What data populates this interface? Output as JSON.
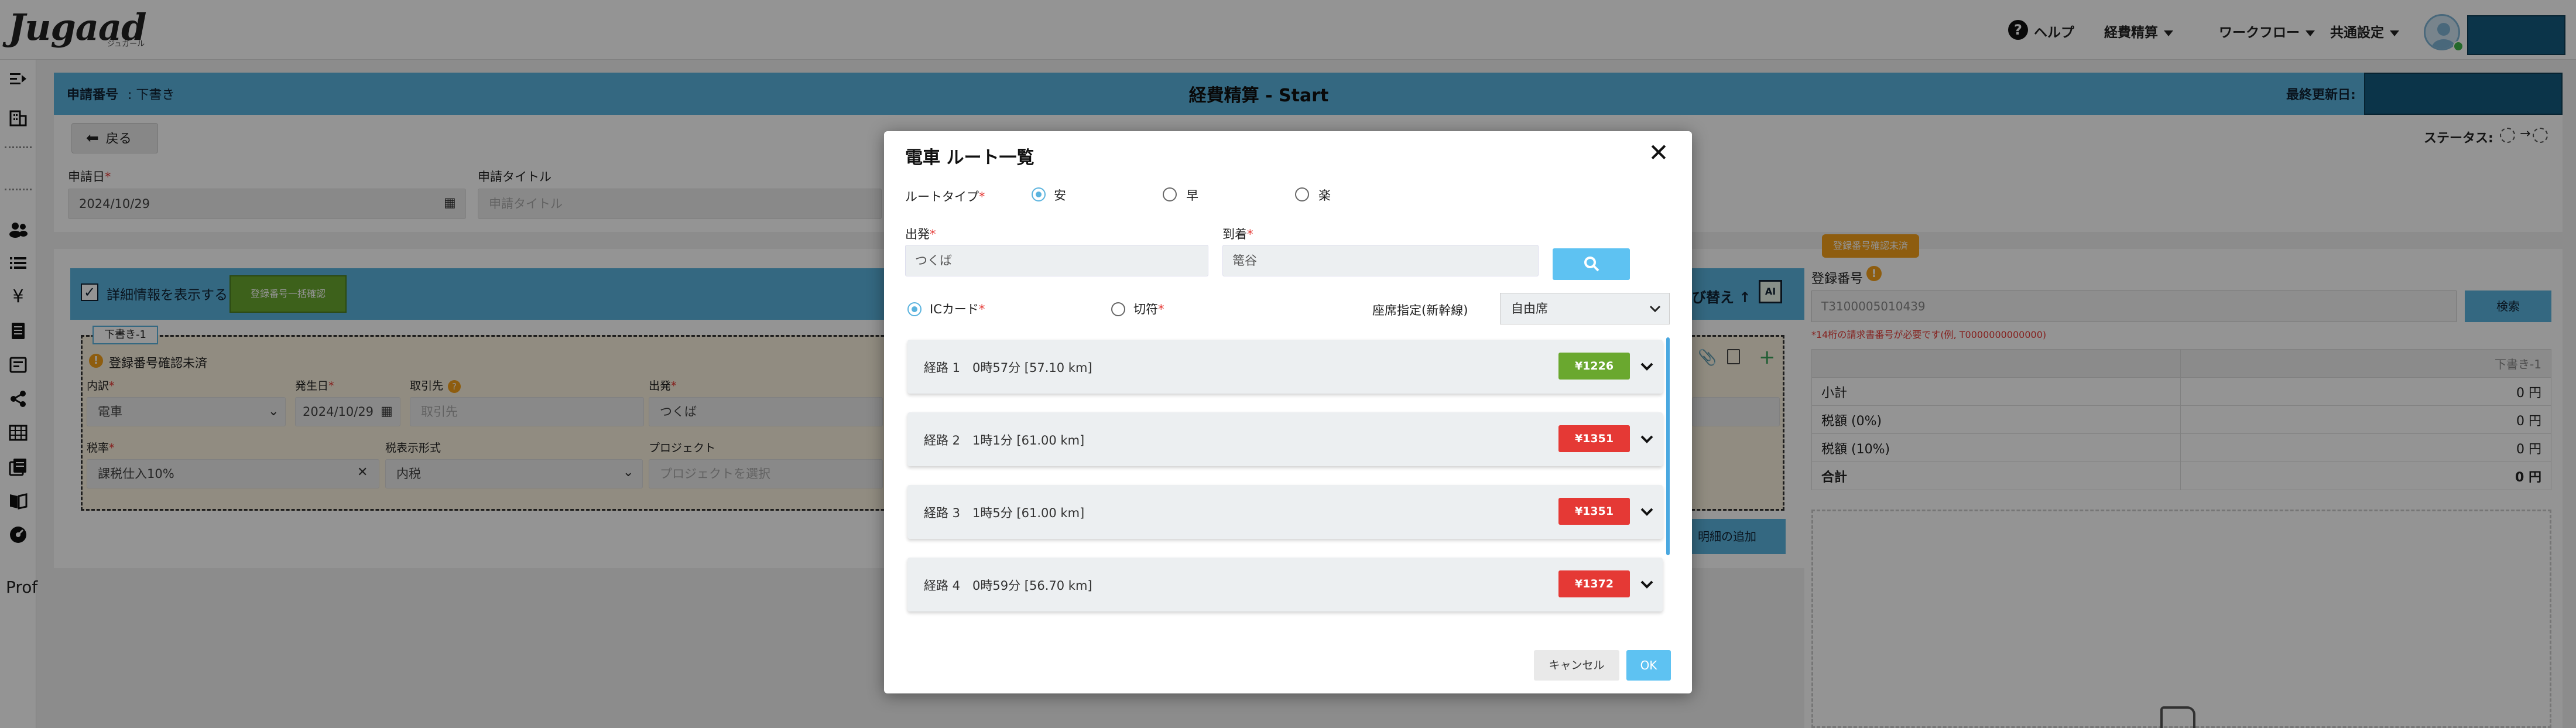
{
  "app": {
    "logo": "Jugaad",
    "logo_sub": "ジュガール"
  },
  "topnav": {
    "help": "ヘルプ",
    "expense": "経費精算",
    "workflow": "ワークフロー",
    "common_settings": "共通設定"
  },
  "rail": {
    "prof": "Prof"
  },
  "page": {
    "app_no_label": "申請番号",
    "app_no_value": ": 下書き",
    "title": "経費精算 - Start",
    "last_updated_label": "最終更新日:",
    "back": "戻る",
    "status_label": "ステータス:",
    "apply_date_label": "申請日",
    "apply_date_value": "2024/10/29",
    "apply_title_label": "申請タイトル",
    "apply_title_placeholder": "申請タイトル"
  },
  "detail": {
    "show_detail": "詳細情報を表示する",
    "bulk_reg_btn": "登録番号一括確認",
    "sort": "び替え ↑",
    "ai_label": "AI",
    "draft_tag": "下書き-1",
    "warning": "登録番号確認未済",
    "type_label": "内訳",
    "type_value": "電車",
    "occur_date_label": "発生日",
    "occur_date_value": "2024/10/29",
    "partner_label": "取引先",
    "partner_placeholder": "取引先",
    "departure_label": "出発",
    "departure_value": "つくば",
    "tax_label": "税率",
    "tax_value": "課税仕入10%",
    "tax_display_label": "税表示形式",
    "tax_display_value": "内税",
    "project_label": "プロジェクト",
    "project_placeholder": "プロジェクトを選択",
    "add_detail": "明細の追加"
  },
  "right": {
    "badge": "登録番号確認未済",
    "reg_label": "登録番号",
    "reg_value": "T3100005010439",
    "search": "検索",
    "note": "*14桁の請求書番号が必要です(例, T0000000000000)",
    "header": "下書き-1",
    "rows": [
      {
        "label": "小計",
        "value": "0 円"
      },
      {
        "label": "税額 (0%)",
        "value": "0 円"
      },
      {
        "label": "税額 (10%)",
        "value": "0 円"
      },
      {
        "label": "合計",
        "value": "0 円"
      }
    ]
  },
  "modal": {
    "title": "電車 ルート一覧",
    "route_type_label": "ルートタイプ",
    "route_types": [
      "安",
      "早",
      "楽"
    ],
    "selected_route_type": "安",
    "departure_label": "出発",
    "departure_value": "つくば",
    "arrival_label": "到着",
    "arrival_value": "篭谷",
    "card_types": [
      "ICカード",
      "切符"
    ],
    "selected_card": "ICカード",
    "seat_label": "座席指定(新幹線)",
    "seat_value": "自由席",
    "routes": [
      {
        "text": "経路 1　0時57分 [57.10 km]",
        "fare": "¥1226",
        "color": "#6aa82f"
      },
      {
        "text": "経路 2　1時1分 [61.00 km]",
        "fare": "¥1351",
        "color": "#e53935"
      },
      {
        "text": "経路 3　1時5分 [61.00 km]",
        "fare": "¥1351",
        "color": "#e53935"
      },
      {
        "text": "経路 4　0時59分 [56.70 km]",
        "fare": "¥1372",
        "color": "#e53935"
      }
    ],
    "cancel": "キャンセル",
    "ok": "OK"
  }
}
